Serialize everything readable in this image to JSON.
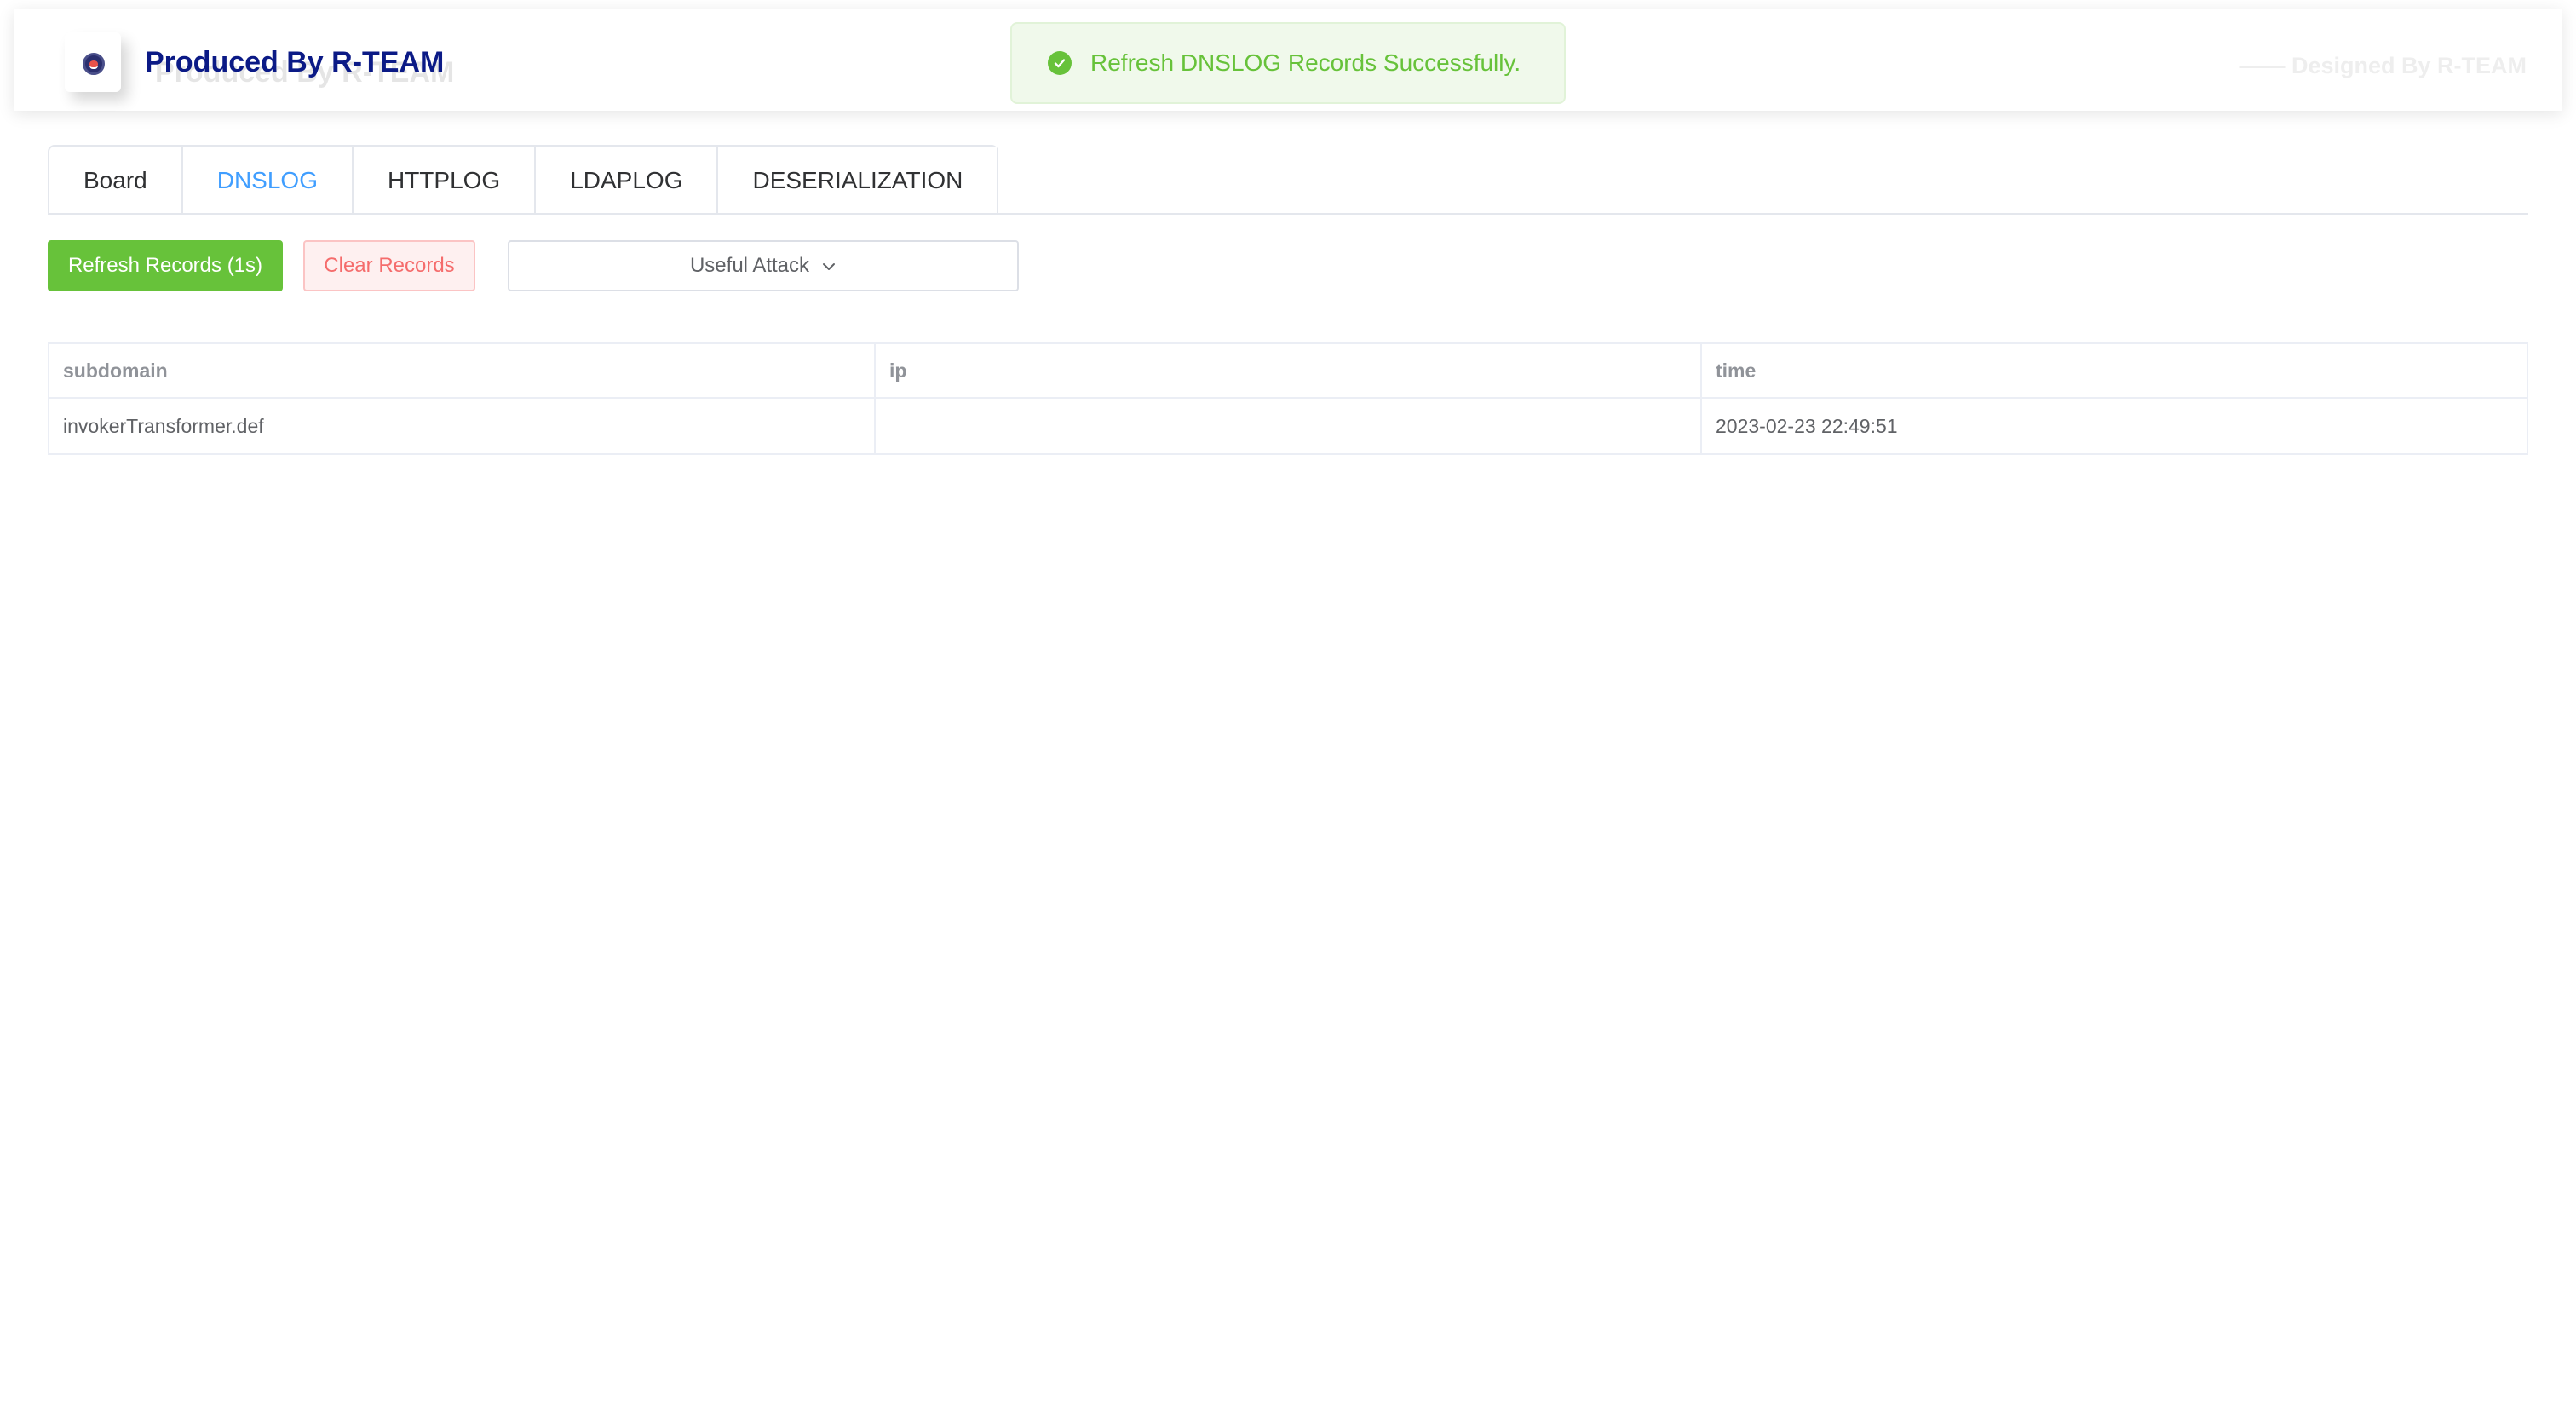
{
  "header": {
    "brand": "Produced By R-TEAM",
    "designed_by": "—— Designed By R-TEAM"
  },
  "toast": {
    "message": "Refresh DNSLOG Records Successfully.",
    "color": "#67c23a"
  },
  "tabs": [
    {
      "label": "Board"
    },
    {
      "label": "DNSLOG",
      "active": true
    },
    {
      "label": "HTTPLOG"
    },
    {
      "label": "LDAPLOG"
    },
    {
      "label": "DESERIALIZATION"
    }
  ],
  "actions": {
    "refresh_label": "Refresh Records (1s)",
    "clear_label": "Clear Records",
    "attack_label": "Useful Attack"
  },
  "table": {
    "columns": [
      "subdomain",
      "ip",
      "time"
    ],
    "rows": [
      {
        "subdomain": "invokerTransformer.def",
        "ip": "",
        "time": "2023-02-23 22:49:51"
      }
    ]
  },
  "colors": {
    "accent": "#409eff",
    "success": "#67c23a",
    "danger": "#f56c6c",
    "brand": "#0b1a86"
  },
  "icons": {
    "toast": "check-circle-icon",
    "dropdown": "chevron-down-icon",
    "logo": "pokeball-logo-icon"
  }
}
